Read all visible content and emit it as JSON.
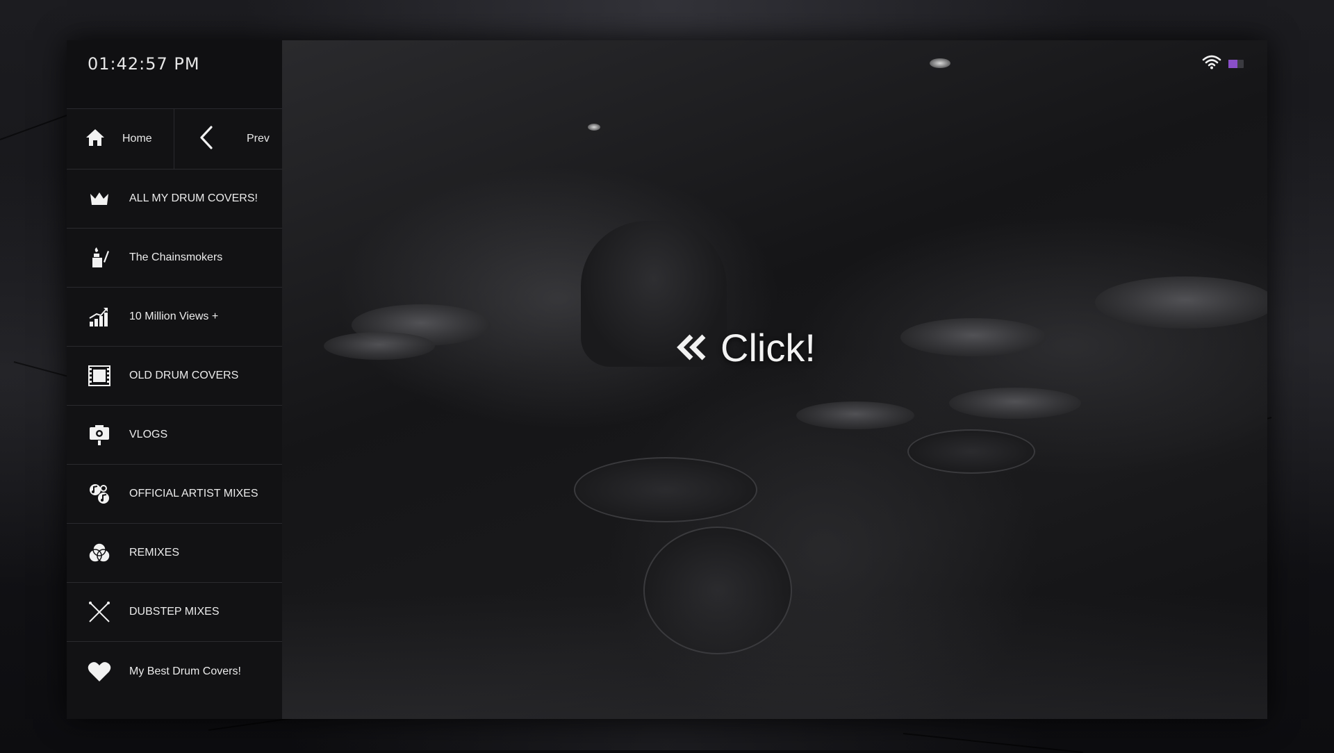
{
  "status_bar": {
    "time": "01:42:57 PM",
    "battery_color": "#8a4fc8",
    "battery_level": 0.6
  },
  "nav": {
    "home_label": "Home",
    "prev_label": "Prev"
  },
  "menu": {
    "items": [
      {
        "label": "ALL MY DRUM COVERS!",
        "icon": "crown-icon"
      },
      {
        "label": "The Chainsmokers",
        "icon": "lighter-icon"
      },
      {
        "label": "10 Million Views +",
        "icon": "growth-chart-icon"
      },
      {
        "label": "OLD DRUM COVERS",
        "icon": "film-strip-icon"
      },
      {
        "label": "VLOGS",
        "icon": "camera-icon"
      },
      {
        "label": "OFFICIAL ARTIST MIXES",
        "icon": "music-notes-icon"
      },
      {
        "label": "REMIXES",
        "icon": "venn-icon"
      },
      {
        "label": "DUBSTEP MIXES",
        "icon": "crossed-sticks-icon"
      },
      {
        "label": "My Best Drum Covers!",
        "icon": "heart-icon"
      }
    ]
  },
  "main": {
    "cta_label": "Click!"
  }
}
